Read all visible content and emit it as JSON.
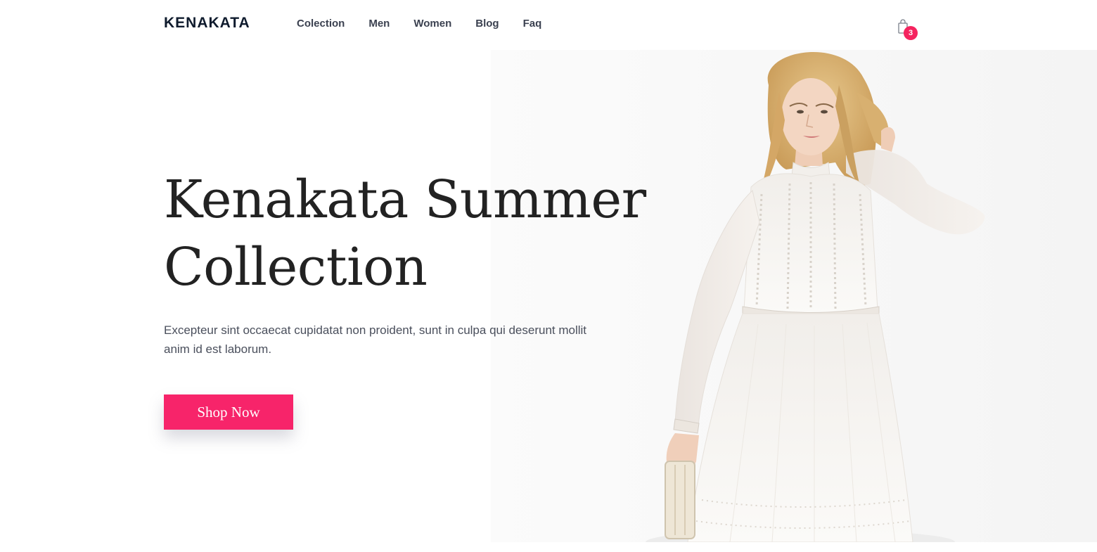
{
  "header": {
    "logo": "KENAKATA",
    "nav": [
      "Colection",
      "Men",
      "Women",
      "Blog",
      "Faq"
    ],
    "cart": {
      "icon": "shopping-bag-icon",
      "count": "3"
    }
  },
  "hero": {
    "title_line1": "Kenakata Summer",
    "title_line2": "Collection",
    "description": "Excepteur sint occaecat cupidatat non proident, sunt in culpa qui deserunt mollit anim id est laborum.",
    "cta_label": "Shop Now"
  },
  "colors": {
    "accent": "#f7246a",
    "badge": "#f5245f",
    "logo": "#0f1b2d",
    "nav_text": "#3b4150",
    "title_text": "#222222",
    "body_text": "#4a4f5c"
  }
}
